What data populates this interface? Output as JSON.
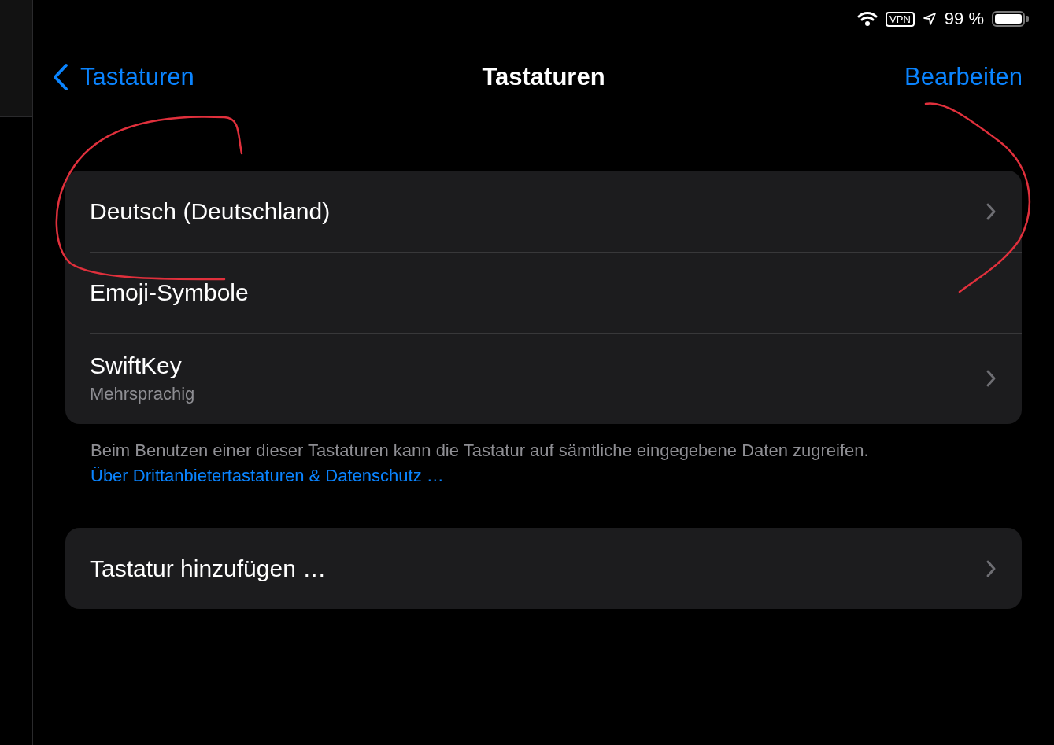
{
  "status_bar": {
    "vpn": "VPN",
    "battery_percent": "99 %"
  },
  "nav": {
    "back": "Tastaturen",
    "title": "Tastaturen",
    "action": "Bearbeiten"
  },
  "keyboards": [
    {
      "title": "Deutsch (Deutschland)",
      "chevron": true
    },
    {
      "title": "Emoji-Symbole",
      "chevron": false
    },
    {
      "title": "SwiftKey",
      "subtitle": "Mehrsprachig",
      "chevron": true
    }
  ],
  "footer": {
    "text": "Beim Benutzen einer dieser Tastaturen kann die Tastatur auf sämtliche eingegebene Daten zugreifen.",
    "link": "Über Drittanbietertastaturen & Datenschutz …"
  },
  "add_keyboard": {
    "title": "Tastatur hinzufügen …",
    "chevron": true
  }
}
